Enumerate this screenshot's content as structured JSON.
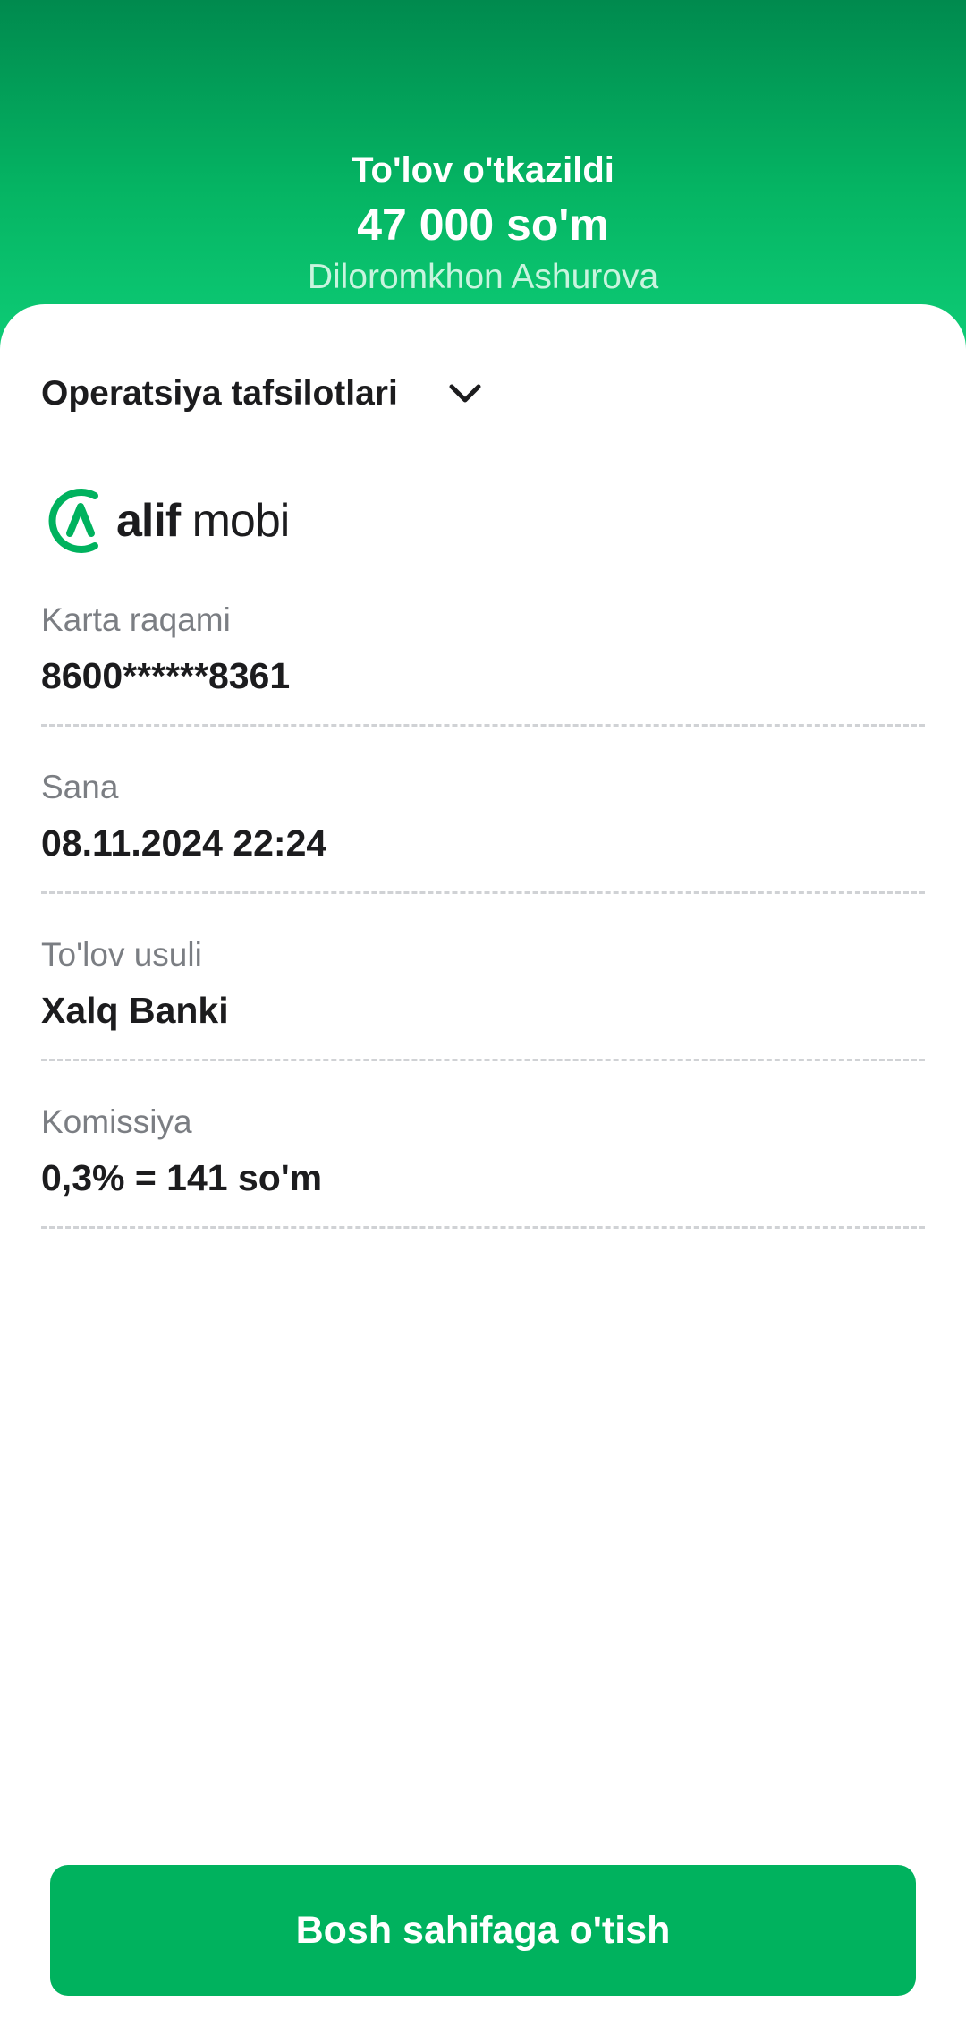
{
  "header": {
    "status_title": "To'lov o'tkazildi",
    "amount": "47 000 so'm",
    "recipient": "Diloromkhon Ashurova"
  },
  "details": {
    "title": "Operatsiya tafsilotlari",
    "logo": {
      "brand_bold": "alif",
      "brand_regular": "mobi"
    },
    "rows": [
      {
        "label": "Karta raqami",
        "value": "8600******8361"
      },
      {
        "label": "Sana",
        "value": "08.11.2024 22:24"
      },
      {
        "label": "To'lov usuli",
        "value": "Xalq Banki"
      },
      {
        "label": "Komissiya",
        "value": "0,3% = 141 so'm"
      }
    ]
  },
  "footer": {
    "home_button_label": "Bosh sahifaga o'tish"
  },
  "colors": {
    "brand_green": "#00b25e",
    "header_gradient_top": "#008a4e",
    "header_gradient_bottom": "#0fd079"
  },
  "icons": {
    "expand": "chevron-down-icon",
    "logo": "alif-logo-icon"
  }
}
